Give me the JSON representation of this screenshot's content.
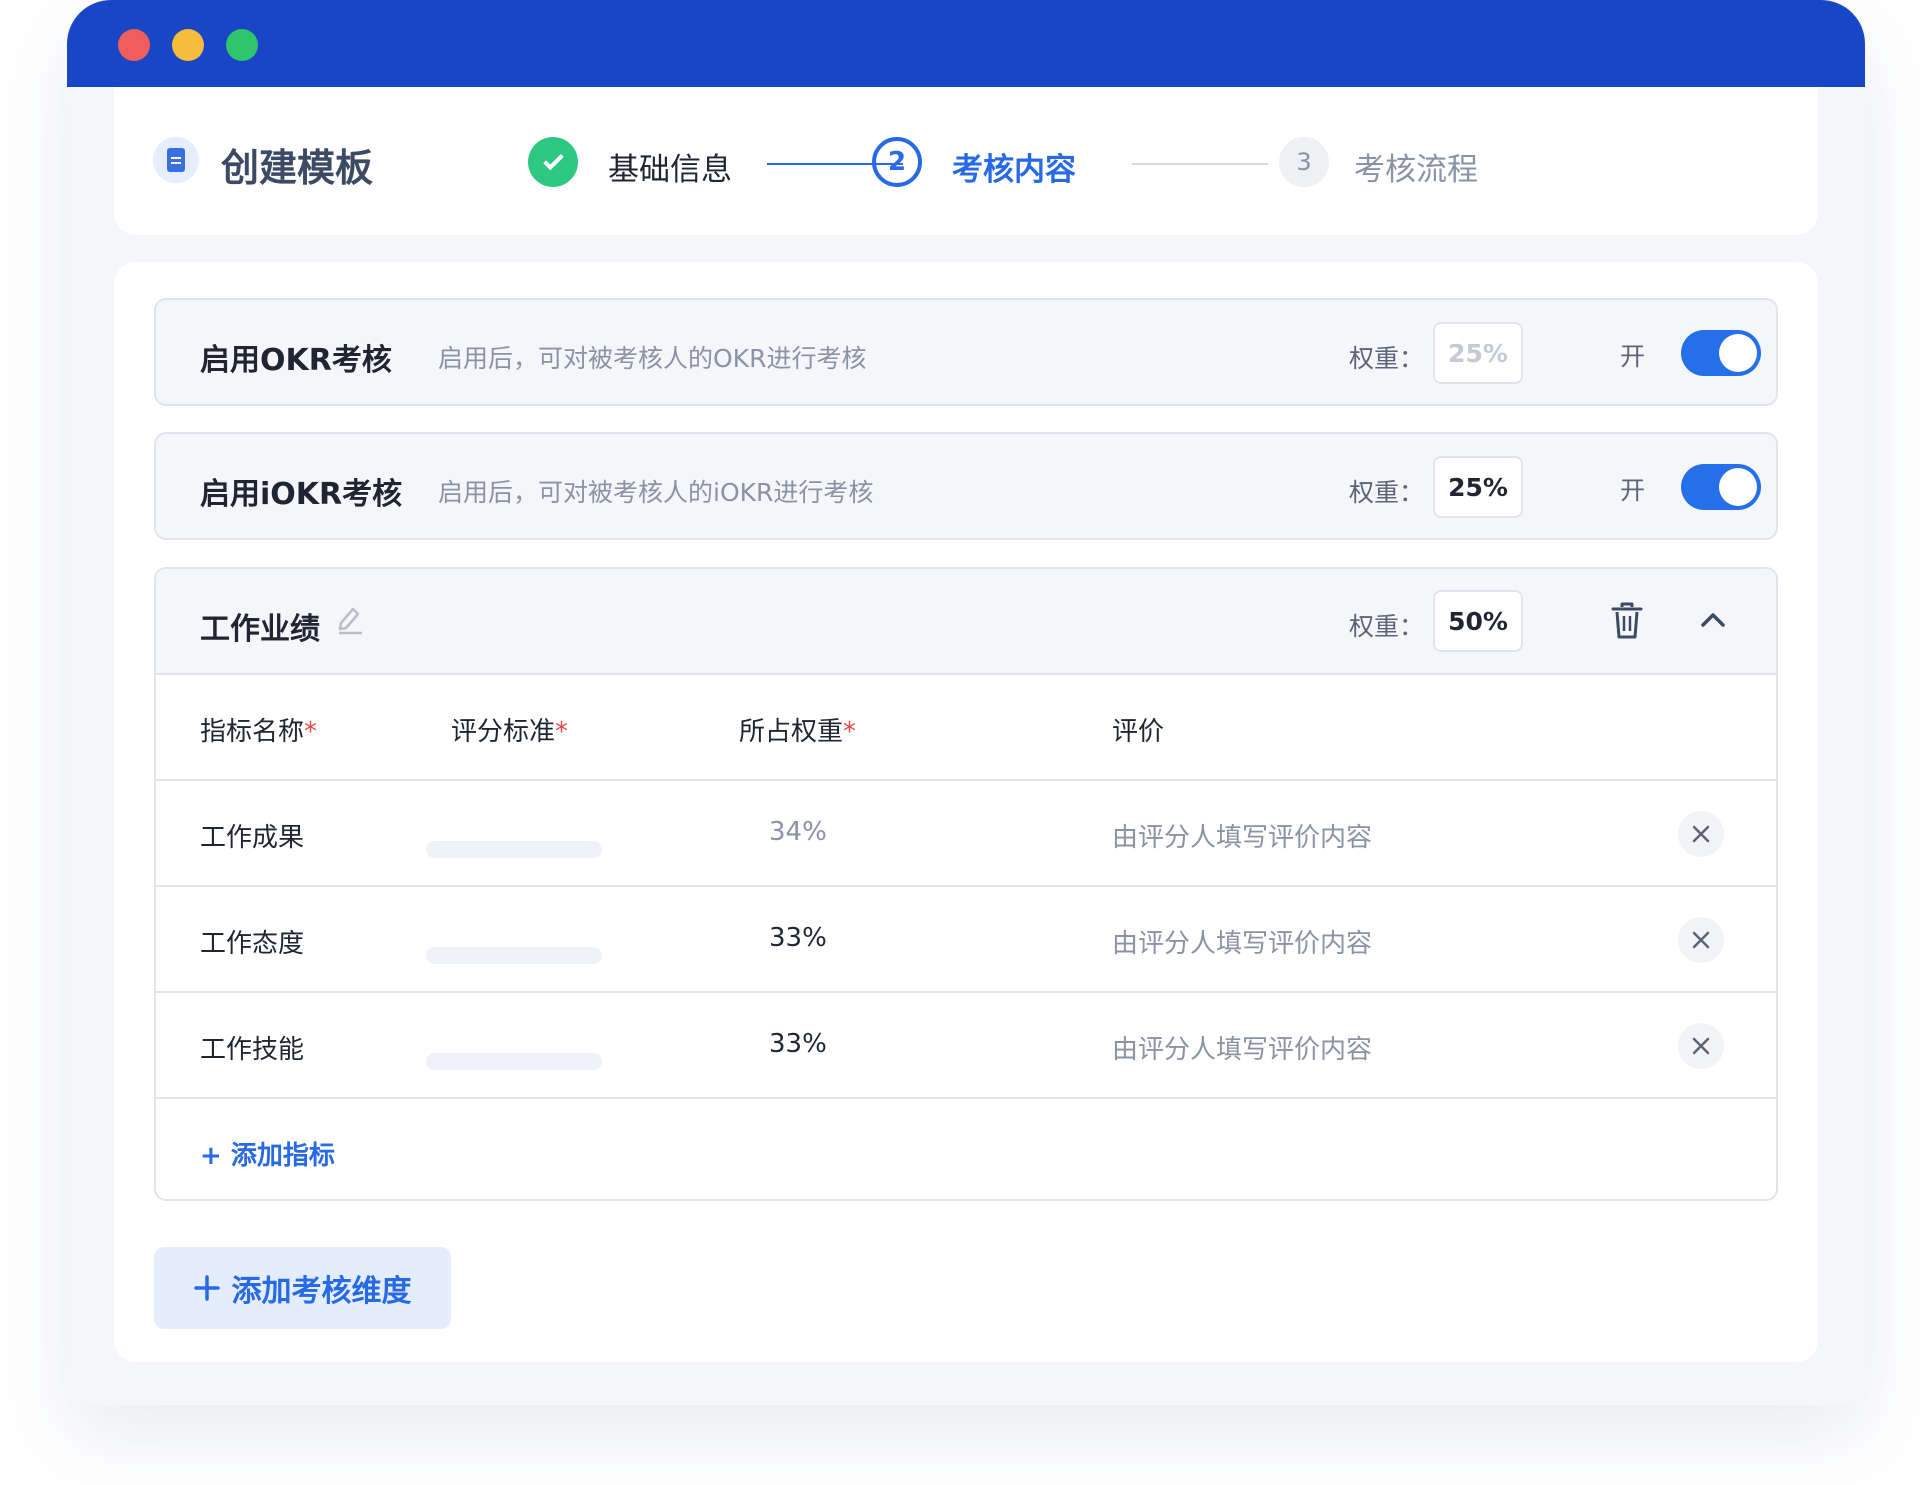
{
  "header": {
    "title": "创建模板",
    "steps": [
      {
        "number": "",
        "label": "基础信息",
        "status": "done"
      },
      {
        "number": "2",
        "label": "考核内容",
        "status": "current"
      },
      {
        "number": "3",
        "label": "考核流程",
        "status": "pending"
      }
    ]
  },
  "okr": {
    "title": "启用OKR考核",
    "description": "启用后，可对被考核人的OKR进行考核",
    "weight_label": "权重：",
    "weight": "25%",
    "toggle_label": "开",
    "enabled": true
  },
  "iokr": {
    "title": "启用iOKR考核",
    "description": "启用后，可对被考核人的iOKR进行考核",
    "weight_label": "权重：",
    "weight": "25%",
    "toggle_label": "开",
    "enabled": true
  },
  "dimension": {
    "title": "工作业绩",
    "weight_label": "权重：",
    "weight": "50%",
    "columns": [
      {
        "label": "指标名称",
        "required": "*"
      },
      {
        "label": "评分标准",
        "required": "*"
      },
      {
        "label": "所占权重",
        "required": "*"
      },
      {
        "label": "评价",
        "required": ""
      }
    ],
    "rows": [
      {
        "name": "工作成果",
        "weight": "34%",
        "evaluation": "由评分人填写评价内容"
      },
      {
        "name": "工作态度",
        "weight": "33%",
        "evaluation": "由评分人填写评价内容"
      },
      {
        "name": "工作技能",
        "weight": "33%",
        "evaluation": "由评分人填写评价内容"
      }
    ],
    "add_metric_label": "+ 添加指标"
  },
  "add_dimension_label": "添加考核维度",
  "icons": {
    "doc": "document-icon",
    "check": "check-icon",
    "edit": "pencil-icon",
    "trash": "trash-icon",
    "collapse": "chevron-up-icon",
    "remove": "close-icon",
    "add": "plus-icon"
  },
  "colors": {
    "accent": "#2869e6",
    "titlebar": "#1846c4",
    "success": "#2ec882",
    "required": "#e54a4a"
  }
}
